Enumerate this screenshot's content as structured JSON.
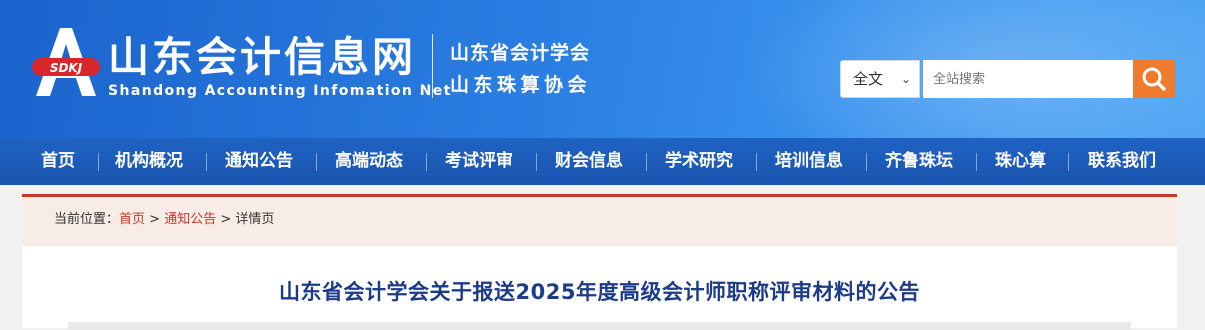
{
  "header": {
    "logo_badge": "SDKJ",
    "site_title": "山东会计信息网",
    "site_subtitle": "Shandong Accounting Infomation Net",
    "org_line1": "山东省会计学会",
    "org_line2": "山东珠算协会"
  },
  "search": {
    "scope_selected": "全文",
    "placeholder": "全站搜索",
    "button_icon": "search-icon"
  },
  "nav": {
    "items": [
      "首页",
      "机构概况",
      "通知公告",
      "高端动态",
      "考试评审",
      "财会信息",
      "学术研究",
      "培训信息",
      "齐鲁珠坛",
      "珠心算",
      "联系我们"
    ]
  },
  "breadcrumb": {
    "label": "当前位置：",
    "home": "首页",
    "section": "通知公告",
    "current": "详情页",
    "separator": ">"
  },
  "article": {
    "title": "山东省会计学会关于报送2025年度高级会计师职称评审材料的公告"
  },
  "colors": {
    "header_blue": "#2a7ee2",
    "nav_blue": "#1f62c4",
    "search_button": "#f07b2d",
    "accent_red": "#c8362d",
    "title_blue": "#1d3c87"
  }
}
